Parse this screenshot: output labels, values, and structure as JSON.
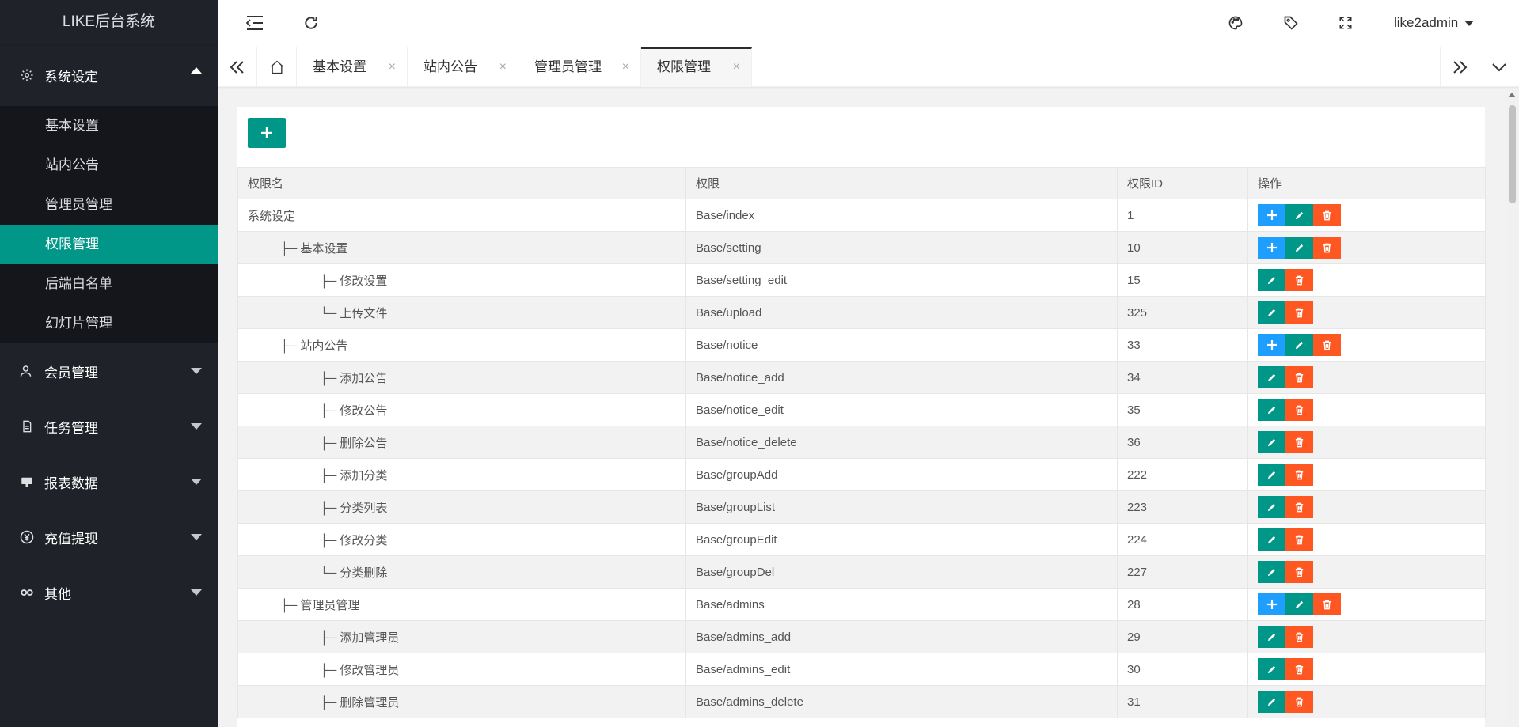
{
  "app": {
    "title": "LIKE后台系统"
  },
  "sidebar": {
    "groups": [
      {
        "label": "系统设定",
        "icon": "gear-icon",
        "expanded": true,
        "items": [
          "基本设置",
          "站内公告",
          "管理员管理",
          "权限管理",
          "后端白名单",
          "幻灯片管理"
        ],
        "active_item": "权限管理"
      },
      {
        "label": "会员管理",
        "icon": "user-icon",
        "expanded": false
      },
      {
        "label": "任务管理",
        "icon": "file-icon",
        "expanded": false
      },
      {
        "label": "报表数据",
        "icon": "chart-icon",
        "expanded": false
      },
      {
        "label": "充值提现",
        "icon": "yen-icon",
        "expanded": false
      },
      {
        "label": "其他",
        "icon": "link-icon",
        "expanded": false
      }
    ]
  },
  "header": {
    "user": "like2admin"
  },
  "tabs": [
    {
      "label": "基本设置",
      "closable": true
    },
    {
      "label": "站内公告",
      "closable": true
    },
    {
      "label": "管理员管理",
      "closable": true
    },
    {
      "label": "权限管理",
      "closable": true,
      "active": true
    }
  ],
  "table": {
    "columns": [
      "权限名",
      "权限",
      "权限ID",
      "操作"
    ],
    "rows": [
      {
        "name": "系统设定",
        "perm": "Base/index",
        "id": "1",
        "ops": [
          "add",
          "edit",
          "del"
        ]
      },
      {
        "name": "├─ 基本设置",
        "perm": "Base/setting",
        "id": "10",
        "ops": [
          "add",
          "edit",
          "del"
        ]
      },
      {
        "name": "├─ 修改设置",
        "perm": "Base/setting_edit",
        "id": "15",
        "ops": [
          "edit",
          "del"
        ]
      },
      {
        "name": "└─ 上传文件",
        "perm": "Base/upload",
        "id": "325",
        "ops": [
          "edit",
          "del"
        ]
      },
      {
        "name": "├─ 站内公告",
        "perm": "Base/notice",
        "id": "33",
        "ops": [
          "add",
          "edit",
          "del"
        ]
      },
      {
        "name": "├─ 添加公告",
        "perm": "Base/notice_add",
        "id": "34",
        "ops": [
          "edit",
          "del"
        ]
      },
      {
        "name": "├─ 修改公告",
        "perm": "Base/notice_edit",
        "id": "35",
        "ops": [
          "edit",
          "del"
        ]
      },
      {
        "name": "├─ 删除公告",
        "perm": "Base/notice_delete",
        "id": "36",
        "ops": [
          "edit",
          "del"
        ]
      },
      {
        "name": "├─ 添加分类",
        "perm": "Base/groupAdd",
        "id": "222",
        "ops": [
          "edit",
          "del"
        ]
      },
      {
        "name": "├─ 分类列表",
        "perm": "Base/groupList",
        "id": "223",
        "ops": [
          "edit",
          "del"
        ]
      },
      {
        "name": "├─ 修改分类",
        "perm": "Base/groupEdit",
        "id": "224",
        "ops": [
          "edit",
          "del"
        ]
      },
      {
        "name": "└─ 分类删除",
        "perm": "Base/groupDel",
        "id": "227",
        "ops": [
          "edit",
          "del"
        ]
      },
      {
        "name": "├─ 管理员管理",
        "perm": "Base/admins",
        "id": "28",
        "ops": [
          "add",
          "edit",
          "del"
        ]
      },
      {
        "name": "├─ 添加管理员",
        "perm": "Base/admins_add",
        "id": "29",
        "ops": [
          "edit",
          "del"
        ]
      },
      {
        "name": "├─ 修改管理员",
        "perm": "Base/admins_edit",
        "id": "30",
        "ops": [
          "edit",
          "del"
        ]
      },
      {
        "name": "├─ 删除管理员",
        "perm": "Base/admins_delete",
        "id": "31",
        "ops": [
          "edit",
          "del"
        ]
      }
    ]
  },
  "colors": {
    "primary": "#009688",
    "blue": "#1e9fff",
    "danger": "#ff5722",
    "sidebar": "#20222a"
  }
}
